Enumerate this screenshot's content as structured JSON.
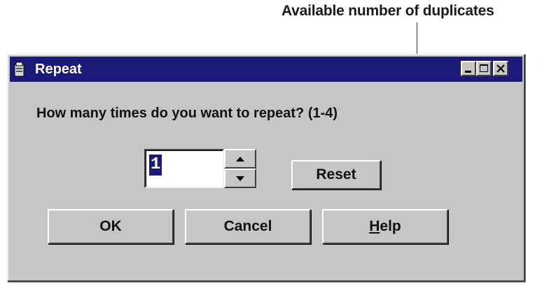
{
  "annotation": {
    "text": "Available number of duplicates"
  },
  "window": {
    "title": "Repeat",
    "icon": "app-icon",
    "controls": [
      "minimize-icon",
      "maximize-icon",
      "close-icon"
    ]
  },
  "dialog": {
    "prompt": "How many times do you want to repeat? (1-4)",
    "spinner": {
      "value": "1",
      "up_icon": "arrow-up-icon",
      "down_icon": "arrow-down-icon"
    },
    "reset_label": "Reset",
    "ok_label": "OK",
    "cancel_label": "Cancel",
    "help_label": {
      "mnemonic": "H",
      "rest": "elp"
    }
  },
  "colors": {
    "titlebar": "#1a1a78",
    "face": "#c6c6c6"
  }
}
